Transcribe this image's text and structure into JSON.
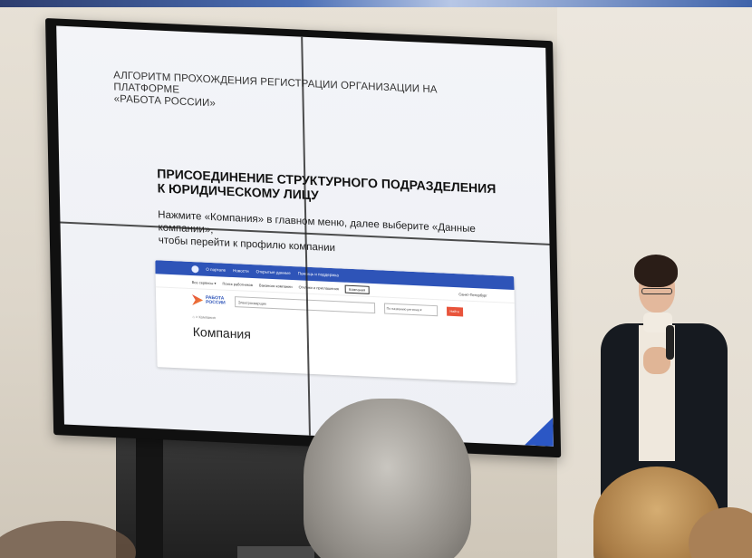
{
  "slide": {
    "title_line1": "АЛГОРИТМ ПРОХОЖДЕНИЯ РЕГИСТРАЦИИ ОРГАНИЗАЦИИ НА ПЛАТФОРМЕ",
    "title_line2": "«РАБОТА РОССИИ»",
    "heading_line1": "ПРИСОЕДИНЕНИЕ СТРУКТУРНОГО ПОДРАЗДЕЛЕНИЯ",
    "heading_line2": "К ЮРИДИЧЕСКОМУ ЛИЦУ",
    "instruction_line1": "Нажмите «Компания» в главном меню, далее выберите «Данные компании»,",
    "instruction_line2": "чтобы перейти к профилю компании"
  },
  "website_mock": {
    "nav": [
      "О портале",
      "Новости",
      "Открытые данные",
      "Помощь и поддержка"
    ],
    "subnav": [
      "Все сервисы ▾",
      "Поиск работников",
      "Вакансии компании",
      "Отклики и приглашения"
    ],
    "active_tab": "Компания",
    "login": "Санкт-Петербург",
    "logo_line1": "РАБОТА",
    "logo_line2": "РОССИИ",
    "search_value": "Электросварщик",
    "region_value": "По названию региона ▾",
    "find_button": "Найти",
    "breadcrumb": "⌂ > Компания",
    "page_title": "Компания"
  },
  "colors": {
    "site_nav_blue": "#2e54b8",
    "find_button_red": "#e8543b",
    "corner_accent": "#2b57c5"
  }
}
